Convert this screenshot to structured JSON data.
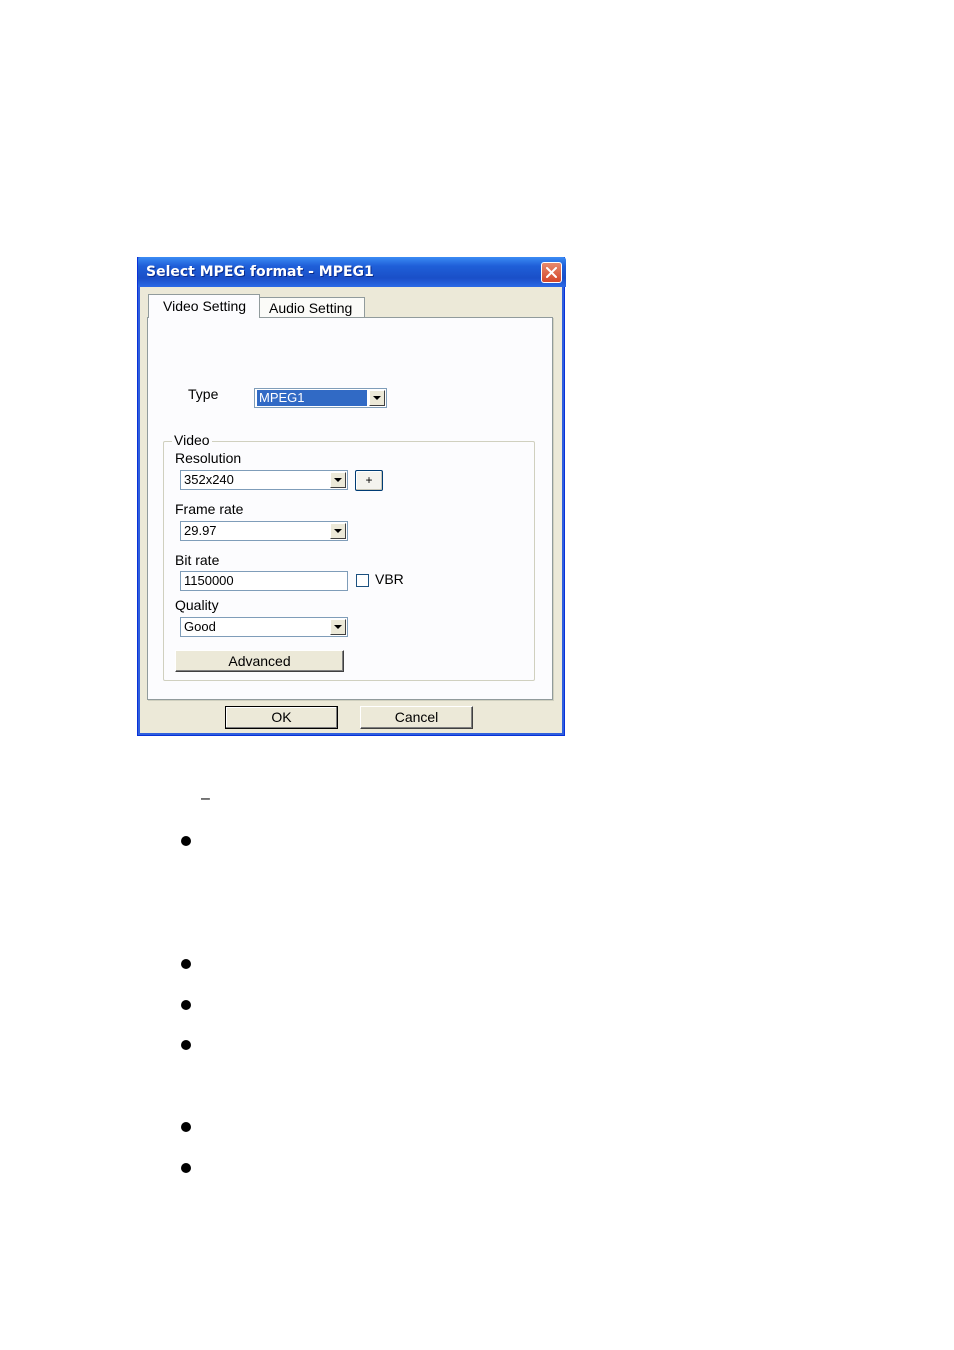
{
  "dialog": {
    "title": "Select MPEG format  - MPEG1",
    "tabs": [
      {
        "label": "Video Setting",
        "active": true
      },
      {
        "label": "Audio Setting",
        "active": false
      }
    ],
    "type_label": "Type",
    "type_value": "MPEG1",
    "video_group": {
      "title": "Video",
      "resolution_label": "Resolution",
      "resolution_value": "352x240",
      "plus_label": "+",
      "framerate_label": "Frame rate",
      "framerate_value": "29.97",
      "bitrate_label": "Bit rate",
      "bitrate_value": "1150000",
      "vbr_label": "VBR",
      "vbr_checked": false,
      "quality_label": "Quality",
      "quality_value": "Good",
      "advanced_label": "Advanced"
    },
    "ok_label": "OK",
    "cancel_label": "Cancel"
  },
  "page": {
    "dash": "–",
    "bullet_count": 6
  },
  "colors": {
    "titlebar": "#1f5fd8",
    "close": "#d4462a",
    "selection": "#316ac5",
    "dialog_bg": "#ece9d8"
  }
}
